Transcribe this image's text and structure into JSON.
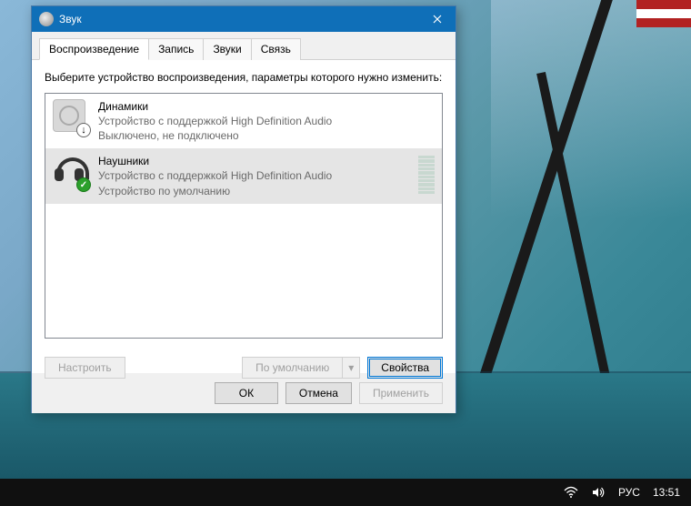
{
  "window": {
    "title": "Звук"
  },
  "tabs": {
    "playback": "Воспроизведение",
    "record": "Запись",
    "sounds": "Звуки",
    "comm": "Связь"
  },
  "instruction": "Выберите устройство воспроизведения, параметры которого нужно изменить:",
  "devices": [
    {
      "name": "Динамики",
      "desc": "Устройство с поддержкой High Definition Audio",
      "status": "Выключено, не подключено"
    },
    {
      "name": "Наушники",
      "desc": "Устройство с поддержкой High Definition Audio",
      "status": "Устройство по умолчанию"
    }
  ],
  "buttons": {
    "configure": "Настроить",
    "default": "По умолчанию",
    "properties": "Свойства",
    "ok": "ОК",
    "cancel": "Отмена",
    "apply": "Применить"
  },
  "taskbar": {
    "lang": "РУС",
    "time": "13:51"
  }
}
